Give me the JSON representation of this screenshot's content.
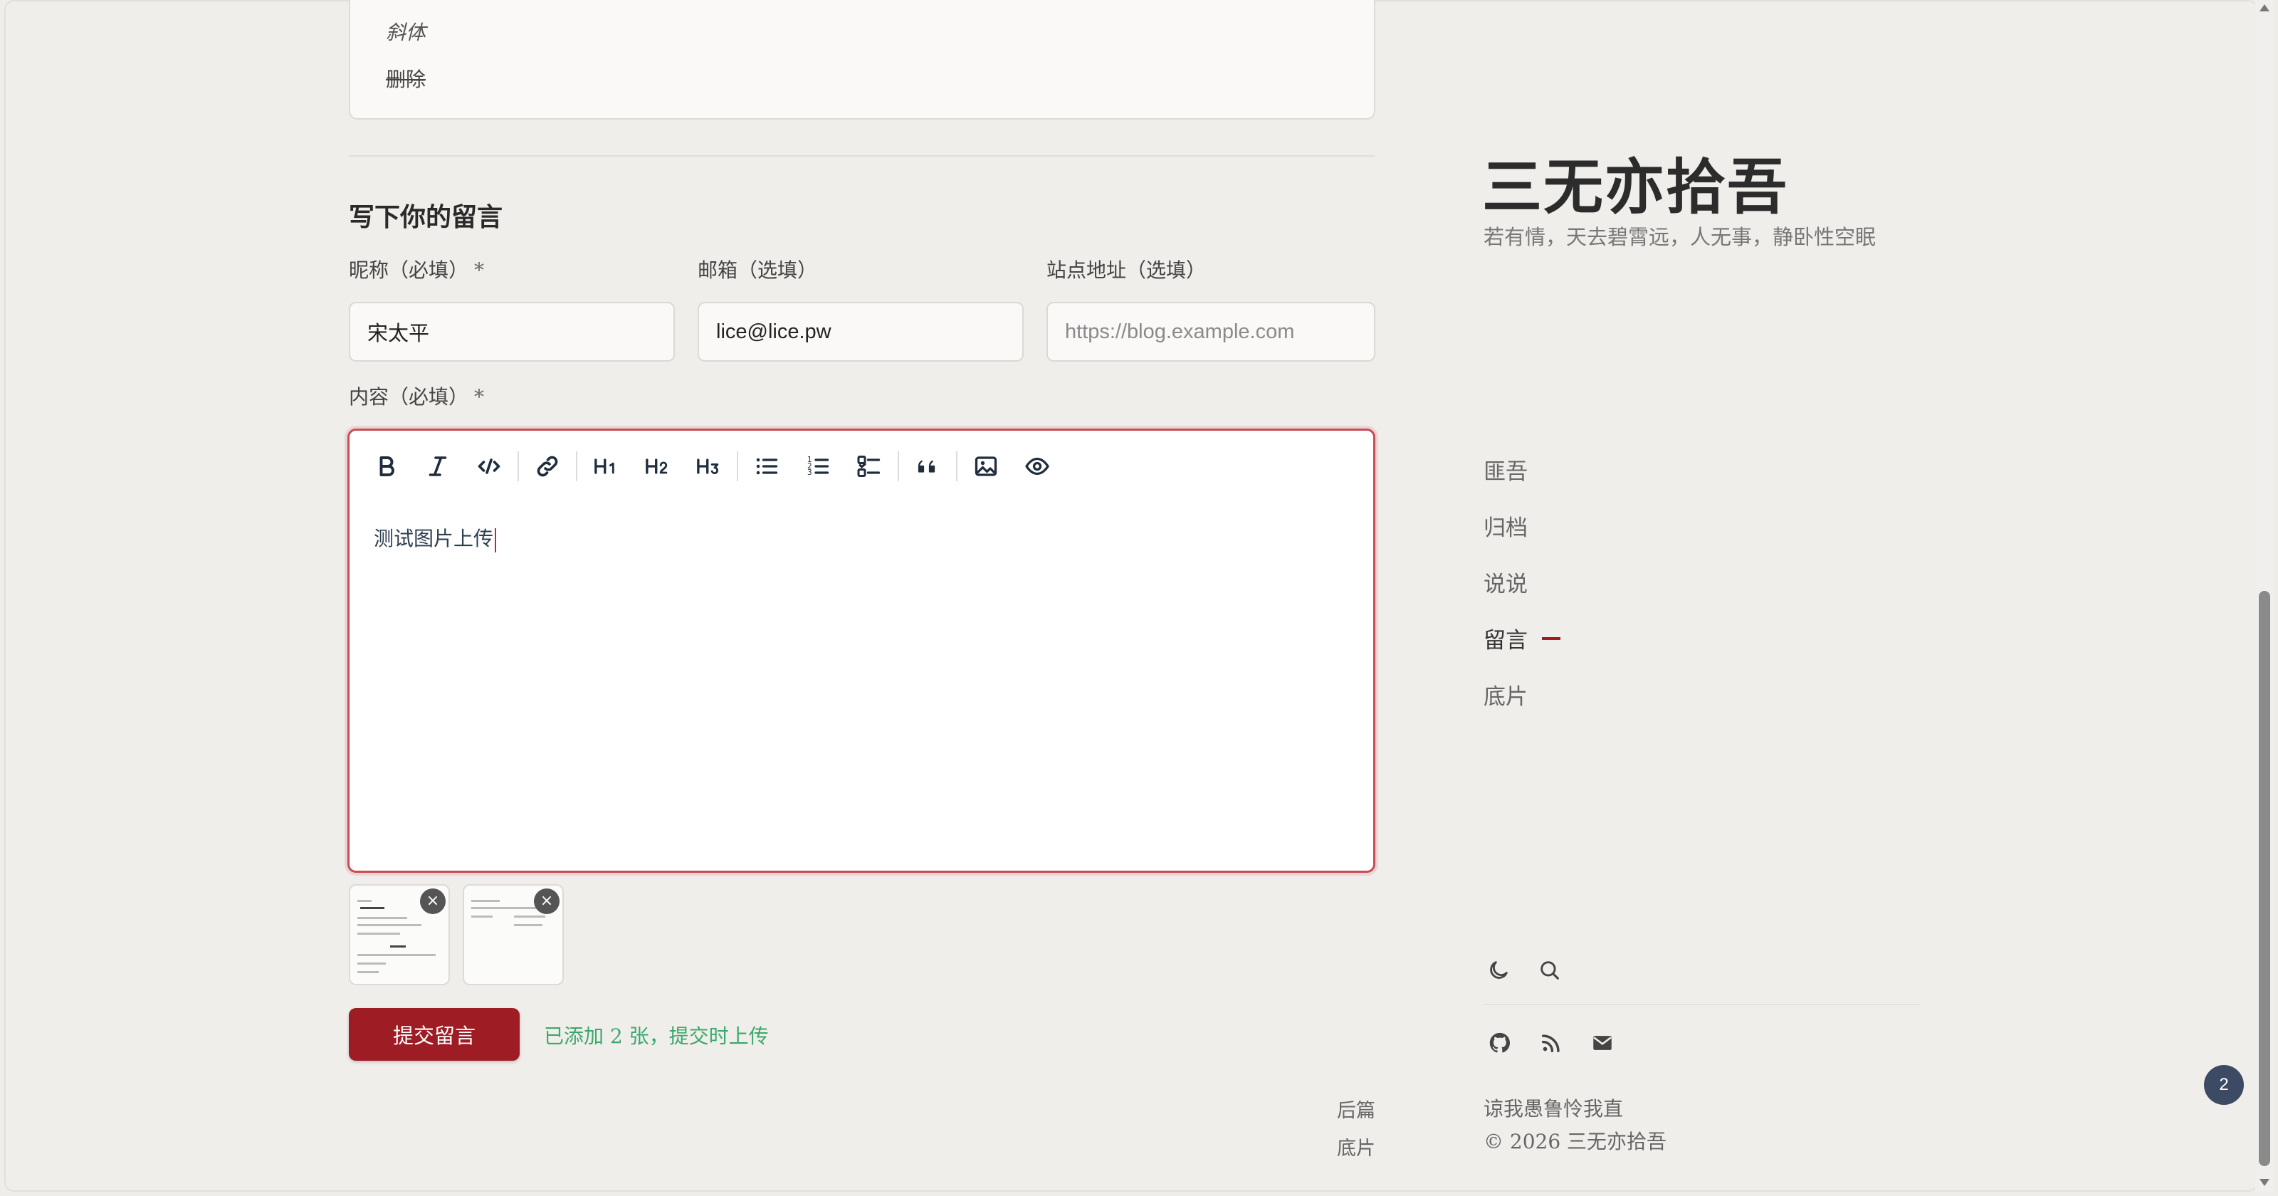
{
  "top_card": {
    "italic_text": "斜体",
    "strike_text": "删除"
  },
  "comment_form": {
    "title": "写下你的留言",
    "nickname": {
      "label": "昵称（必填）",
      "required_mark": "*",
      "value": "宋太平"
    },
    "email": {
      "label": "邮箱（选填）",
      "value": "lice@lice.pw"
    },
    "website": {
      "label": "站点地址（选填）",
      "placeholder": "https://blog.example.com"
    },
    "content": {
      "label": "内容（必填）",
      "required_mark": "*",
      "value": "测试图片上传"
    },
    "toolbar": [
      {
        "icon": "bold-icon",
        "label": "B"
      },
      {
        "icon": "italic-icon",
        "label": "I"
      },
      {
        "icon": "code-icon",
        "label": "</>"
      },
      {
        "icon": "link-icon",
        "label": ""
      },
      {
        "icon": "heading-1-icon",
        "label": "H1"
      },
      {
        "icon": "heading-2-icon",
        "label": "H2"
      },
      {
        "icon": "heading-3-icon",
        "label": "H3"
      },
      {
        "icon": "unordered-list-icon",
        "label": ""
      },
      {
        "icon": "ordered-list-icon",
        "label": ""
      },
      {
        "icon": "task-list-icon",
        "label": ""
      },
      {
        "icon": "quote-icon",
        "label": ""
      },
      {
        "icon": "image-icon",
        "label": ""
      },
      {
        "icon": "preview-eye-icon",
        "label": ""
      }
    ],
    "attachments": [
      {
        "close_label": "×"
      },
      {
        "close_label": "×"
      }
    ],
    "submit_label": "提交留言",
    "upload_status": "已添加 2 张，提交时上传",
    "accent_color": "#9e1c24",
    "status_color": "#3aa86b"
  },
  "post_nav": {
    "next_label": "后篇",
    "next_title": "底片"
  },
  "sidebar": {
    "site_title": "三无亦拾吾",
    "tagline": "若有情，天去碧霄远，人无事，静卧性空眠",
    "menu": [
      {
        "label": "匪吾",
        "active": false
      },
      {
        "label": "归档",
        "active": false
      },
      {
        "label": "说说",
        "active": false
      },
      {
        "label": "留言",
        "active": true
      },
      {
        "label": "底片",
        "active": false
      }
    ],
    "utility_icons": [
      "moon-icon",
      "search-icon"
    ],
    "social_icons": [
      "github-icon",
      "rss-icon",
      "mail-icon"
    ],
    "footer_quote": "谅我愚鲁怜我直",
    "copyright": "© 2026 三无亦拾吾"
  },
  "badge_count": "2"
}
